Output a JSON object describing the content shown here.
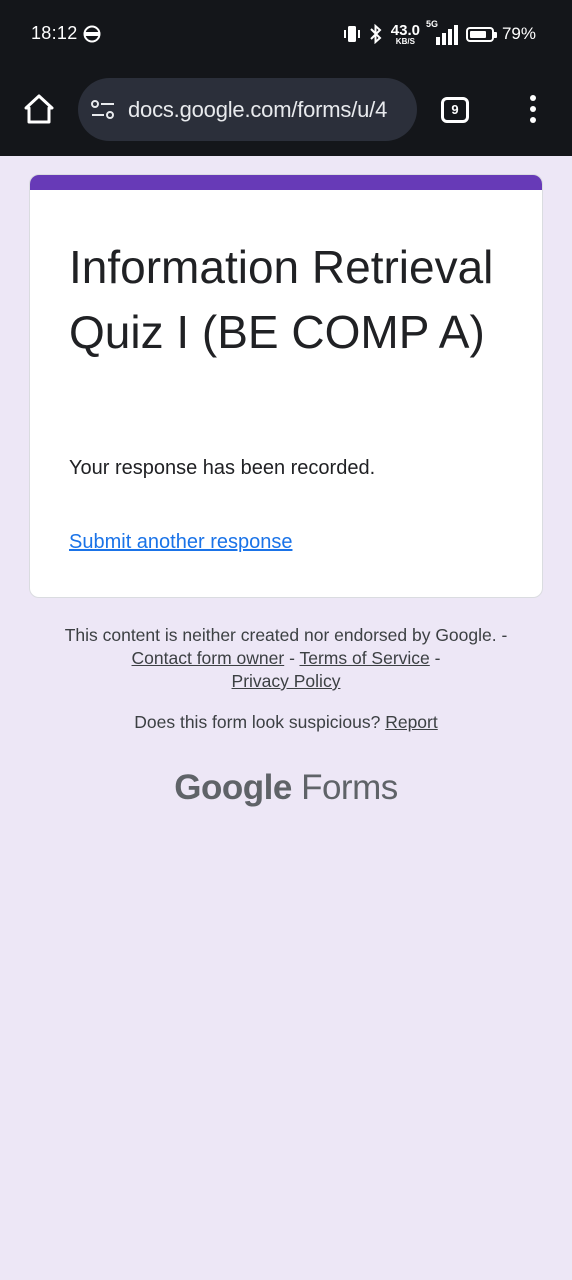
{
  "status_bar": {
    "time": "18:12",
    "net_speed_value": "43.0",
    "net_speed_unit": "KB/S",
    "network_type": "5G",
    "battery_percent": "79%",
    "battery_level": 0.79,
    "icons": [
      "vpn-icon",
      "vibrate-icon",
      "bluetooth-icon",
      "signal-icon",
      "battery-icon"
    ]
  },
  "browser": {
    "url": "docs.google.com/forms/u/4",
    "tab_count": "9",
    "icons": [
      "home-icon",
      "site-settings-icon",
      "tabs-icon",
      "menu-icon"
    ]
  },
  "form": {
    "accent_color": "#673ab7",
    "title": "Information Retrieval Quiz I (BE COMP A)",
    "confirmation": "Your response has been recorded.",
    "submit_another": "Submit another response"
  },
  "footer": {
    "disclaimer_prefix": "This content is neither created nor endorsed by Google. - ",
    "contact_owner": "Contact form owner",
    "separator1": " - ",
    "terms": "Terms of Service",
    "separator2": " - ",
    "privacy": "Privacy Policy",
    "suspicious_text": "Does this form look suspicious? ",
    "report": "Report",
    "brand_google": "Google",
    "brand_forms": "Forms"
  }
}
